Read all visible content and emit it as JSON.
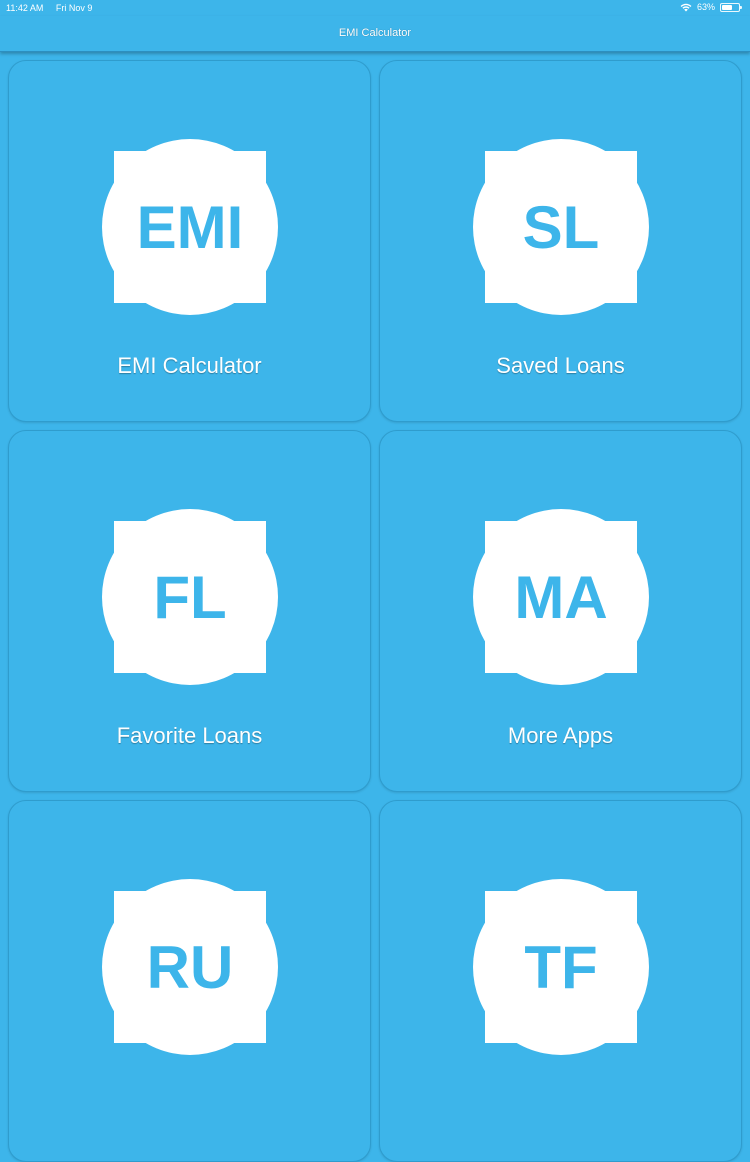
{
  "status_bar": {
    "time": "11:42 AM",
    "date": "Fri Nov 9",
    "battery_level": "63%",
    "battery_fraction": 0.63
  },
  "nav": {
    "title": "EMI Calculator"
  },
  "tiles": [
    {
      "abbr": "EMI",
      "label": "EMI Calculator"
    },
    {
      "abbr": "SL",
      "label": "Saved Loans"
    },
    {
      "abbr": "FL",
      "label": "Favorite Loans"
    },
    {
      "abbr": "MA",
      "label": "More Apps"
    },
    {
      "abbr": "RU",
      "label": ""
    },
    {
      "abbr": "TF",
      "label": ""
    }
  ],
  "colors": {
    "accent": "#3db5ea",
    "text": "#ffffff"
  }
}
